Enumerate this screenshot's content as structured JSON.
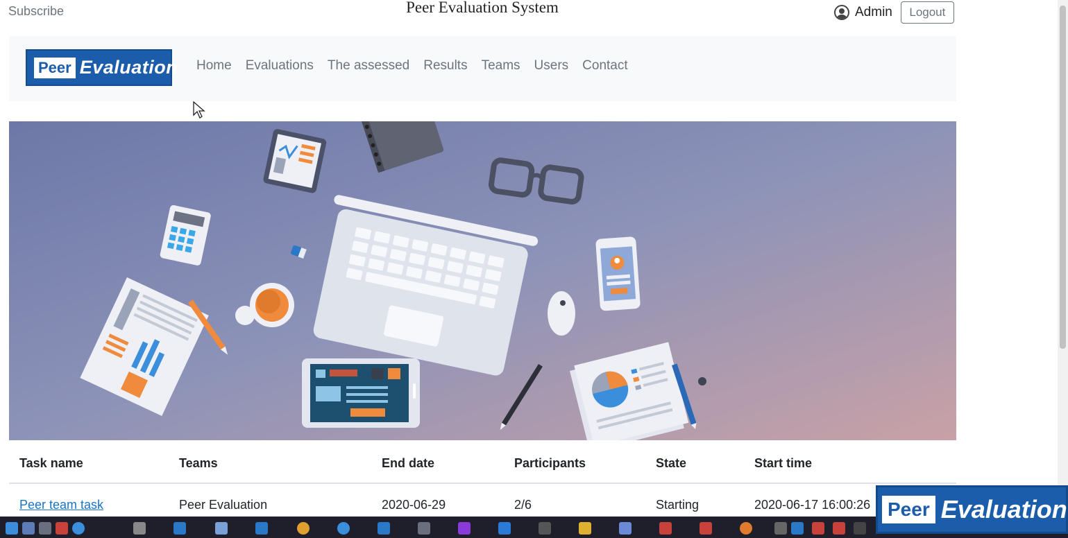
{
  "header": {
    "subscribe": "Subscribe",
    "title": "Peer Evaluation System",
    "user_name": "Admin",
    "logout": "Logout"
  },
  "logo": {
    "peer": "Peer",
    "evaluation": "Evaluation"
  },
  "nav": {
    "items": [
      "Home",
      "Evaluations",
      "The assessed",
      "Results",
      "Teams",
      "Users",
      "Contact"
    ]
  },
  "table": {
    "headers": [
      "Task name",
      "Teams",
      "End date",
      "Participants",
      "State",
      "Start time"
    ],
    "rows": [
      [
        "Peer team task",
        "Peer Evaluation",
        "2020-06-29",
        "2/6",
        "Starting",
        "2020-06-17 16:00:26"
      ]
    ]
  },
  "watermark": {
    "peer": "Peer",
    "evaluation": "Evaluation"
  },
  "colors": {
    "brand": "#1b5daa",
    "link": "#1a73c8",
    "nav_bg": "#f8f9fa",
    "muted": "#6c757d",
    "taskbar": "#1f1f2b"
  },
  "icons": {
    "user": "user-circle-icon",
    "cursor": "mouse-pointer-icon"
  }
}
